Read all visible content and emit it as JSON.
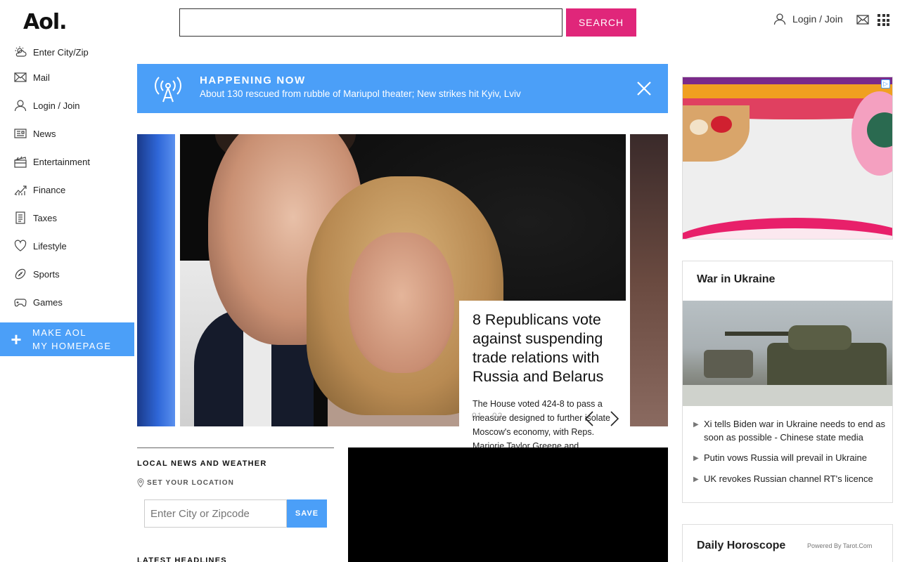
{
  "header": {
    "logo": "Aol.",
    "search_button": "SEARCH",
    "login_label": "Login / Join"
  },
  "sidebar": {
    "items": [
      {
        "label": "Enter City/Zip",
        "icon": "weather-icon"
      },
      {
        "label": "Mail",
        "icon": "mail-icon"
      },
      {
        "label": "Login / Join",
        "icon": "user-icon"
      },
      {
        "label": "News",
        "icon": "news-icon"
      },
      {
        "label": "Entertainment",
        "icon": "clapperboard-icon"
      },
      {
        "label": "Finance",
        "icon": "finance-chart-icon"
      },
      {
        "label": "Taxes",
        "icon": "taxes-icon"
      },
      {
        "label": "Lifestyle",
        "icon": "heart-icon"
      },
      {
        "label": "Sports",
        "icon": "football-icon"
      },
      {
        "label": "Games",
        "icon": "gamepad-icon"
      }
    ],
    "homepage_line1": "MAKE AOL",
    "homepage_line2": "MY HOMEPAGE"
  },
  "banner": {
    "label": "HAPPENING NOW",
    "headline": "About 130 rescued from rubble of Mariupol theater; New strikes hit Kyiv, Lviv"
  },
  "hero": {
    "headline": "8 Republicans vote against suspending trade relations with Russia and Belarus",
    "summary": "The House voted 424-8 to pass a measure designed to further isolate Moscow's economy, with Reps. Marjorie Taylor Greene and",
    "pager": "01 · 02"
  },
  "local": {
    "title": "LOCAL NEWS AND WEATHER",
    "set_location": "SET YOUR LOCATION",
    "zip_placeholder": "Enter City or Zipcode",
    "save_label": "SAVE",
    "latest_headlines": "LATEST HEADLINES"
  },
  "ukraine": {
    "title": "War in Ukraine",
    "items": [
      "Xi tells Biden war in Ukraine needs to end as soon as possible - Chinese state media",
      "Putin vows Russia will prevail in Ukraine",
      "UK revokes Russian channel RT's licence"
    ]
  },
  "horoscope": {
    "title": "Daily Horoscope",
    "powered_by": "Powered By Tarot.Com"
  },
  "colors": {
    "accent_blue": "#4b9ff8",
    "search_pink": "#e0267a"
  }
}
